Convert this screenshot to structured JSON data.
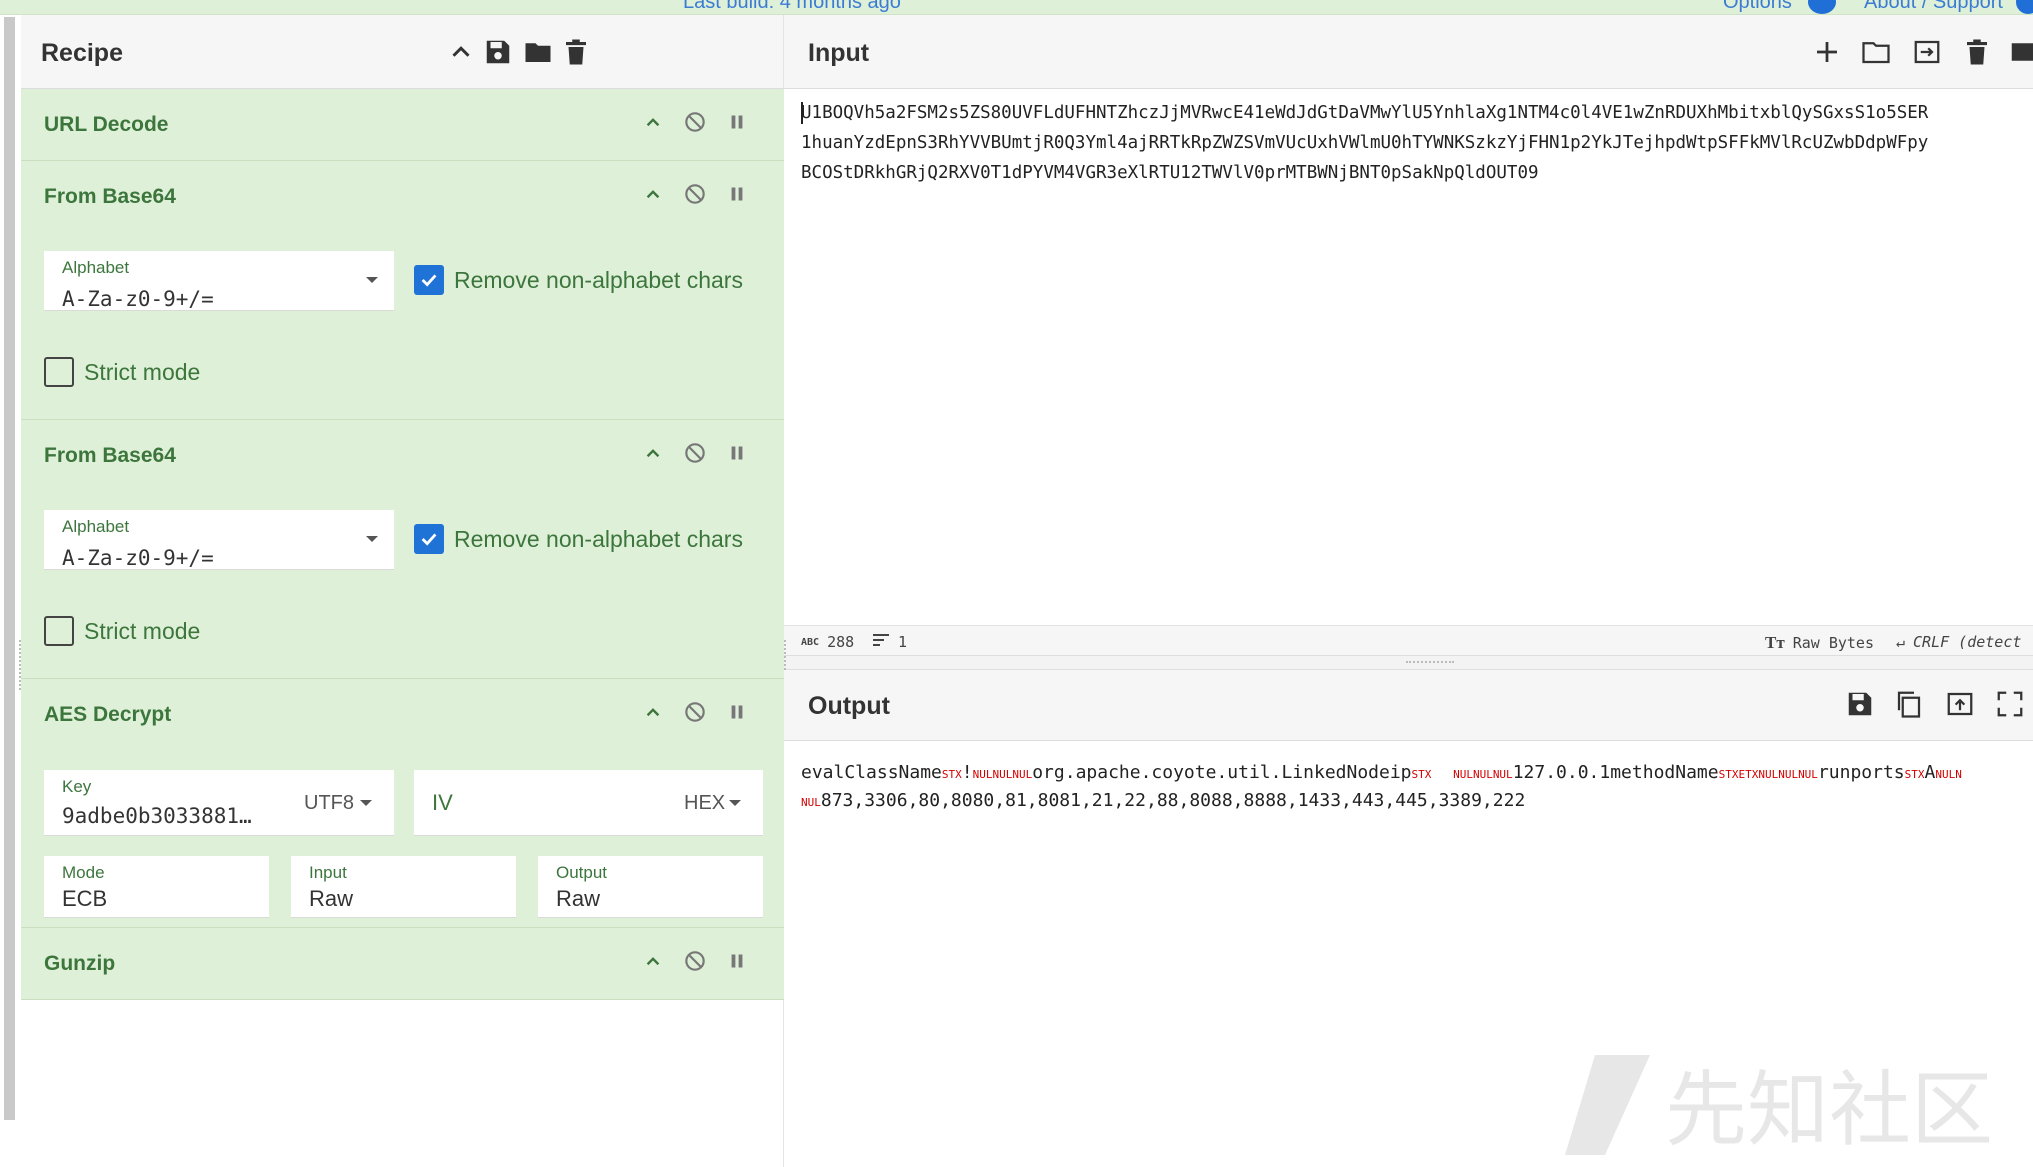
{
  "topbar": {
    "build_text": "Last build: 4 months ago",
    "options_label": "Options",
    "about_label": "About / Support"
  },
  "recipe": {
    "title": "Recipe",
    "operations": [
      {
        "name": "URL Decode"
      },
      {
        "name": "From Base64",
        "alphabet_label": "Alphabet",
        "alphabet_value": "A-Za-z0-9+/=",
        "remove_label": "Remove non-alphabet chars",
        "remove_checked": true,
        "strict_label": "Strict mode",
        "strict_checked": false
      },
      {
        "name": "From Base64",
        "alphabet_label": "Alphabet",
        "alphabet_value": "A-Za-z0-9+/=",
        "remove_label": "Remove non-alphabet chars",
        "remove_checked": true,
        "strict_label": "Strict mode",
        "strict_checked": false
      },
      {
        "name": "AES Decrypt",
        "key_label": "Key",
        "key_value": "9adbe0b3033881…",
        "key_encoding": "UTF8",
        "iv_label": "IV",
        "iv_encoding": "HEX",
        "mode_label": "Mode",
        "mode_value": "ECB",
        "input_label": "Input",
        "input_value": "Raw",
        "output_label": "Output",
        "output_value": "Raw"
      },
      {
        "name": "Gunzip"
      }
    ]
  },
  "input": {
    "title": "Input",
    "lines": [
      "U1BOQVh5a2FSM2s5ZS80UVFLdUFHNTZhczJjMVRwcE41eWdJdGtDaVMwYlU5YnhlaXg1NTM4c0l4VE1wZnRDUXhMbitxblQySGxsS1o5SER",
      "1huanYzdEpnS3RhYVVBUmtjR0Q3Yml4ajRRTkRpZWZSVmVUcUxhVWlmU0hTYWNKSzkzYjFHN1p2YkJTejhpdWtpSFFkMVlRcUZwbDdpWFpy",
      "BCOStDRkhGRjQ2RXV0T1dPYVM4VGR3eXlRTU12TWVlV0prMTBWNjBNT0pSakNpQldOUT09"
    ],
    "char_count": "288",
    "line_count": "1",
    "raw_bytes_label": "Raw Bytes",
    "crlf_label": "CRLF (detect"
  },
  "output": {
    "title": "Output",
    "line1_segments": [
      {
        "t": "evalClassName",
        "c": false
      },
      {
        "t": "STX",
        "c": true
      },
      {
        "t": "!",
        "c": false
      },
      {
        "t": "NULNULNUL",
        "c": true
      },
      {
        "t": "org.apache.coyote.util.LinkedNodeip",
        "c": false
      },
      {
        "t": "STX",
        "c": true
      },
      {
        "t": "  ",
        "c": false
      },
      {
        "t": "NULNULNUL",
        "c": true
      },
      {
        "t": "127.0.0.1methodName",
        "c": false
      },
      {
        "t": "STXETXNULNULNUL",
        "c": true
      },
      {
        "t": "runports",
        "c": false
      },
      {
        "t": "STX",
        "c": true
      },
      {
        "t": "A",
        "c": false
      },
      {
        "t": "NULN",
        "c": true
      }
    ],
    "line2_segments": [
      {
        "t": "NUL",
        "c": true
      },
      {
        "t": "873,3306,80,8080,81,8081,21,22,88,8088,8888,1433,443,445,3389,222",
        "c": false
      }
    ]
  },
  "watermark": {
    "text": "先知社区"
  },
  "colors": {
    "op_bg": "#dff0d8",
    "op_text": "#3c763d",
    "accent": "#1f73d6",
    "control_char": "#d40000"
  }
}
